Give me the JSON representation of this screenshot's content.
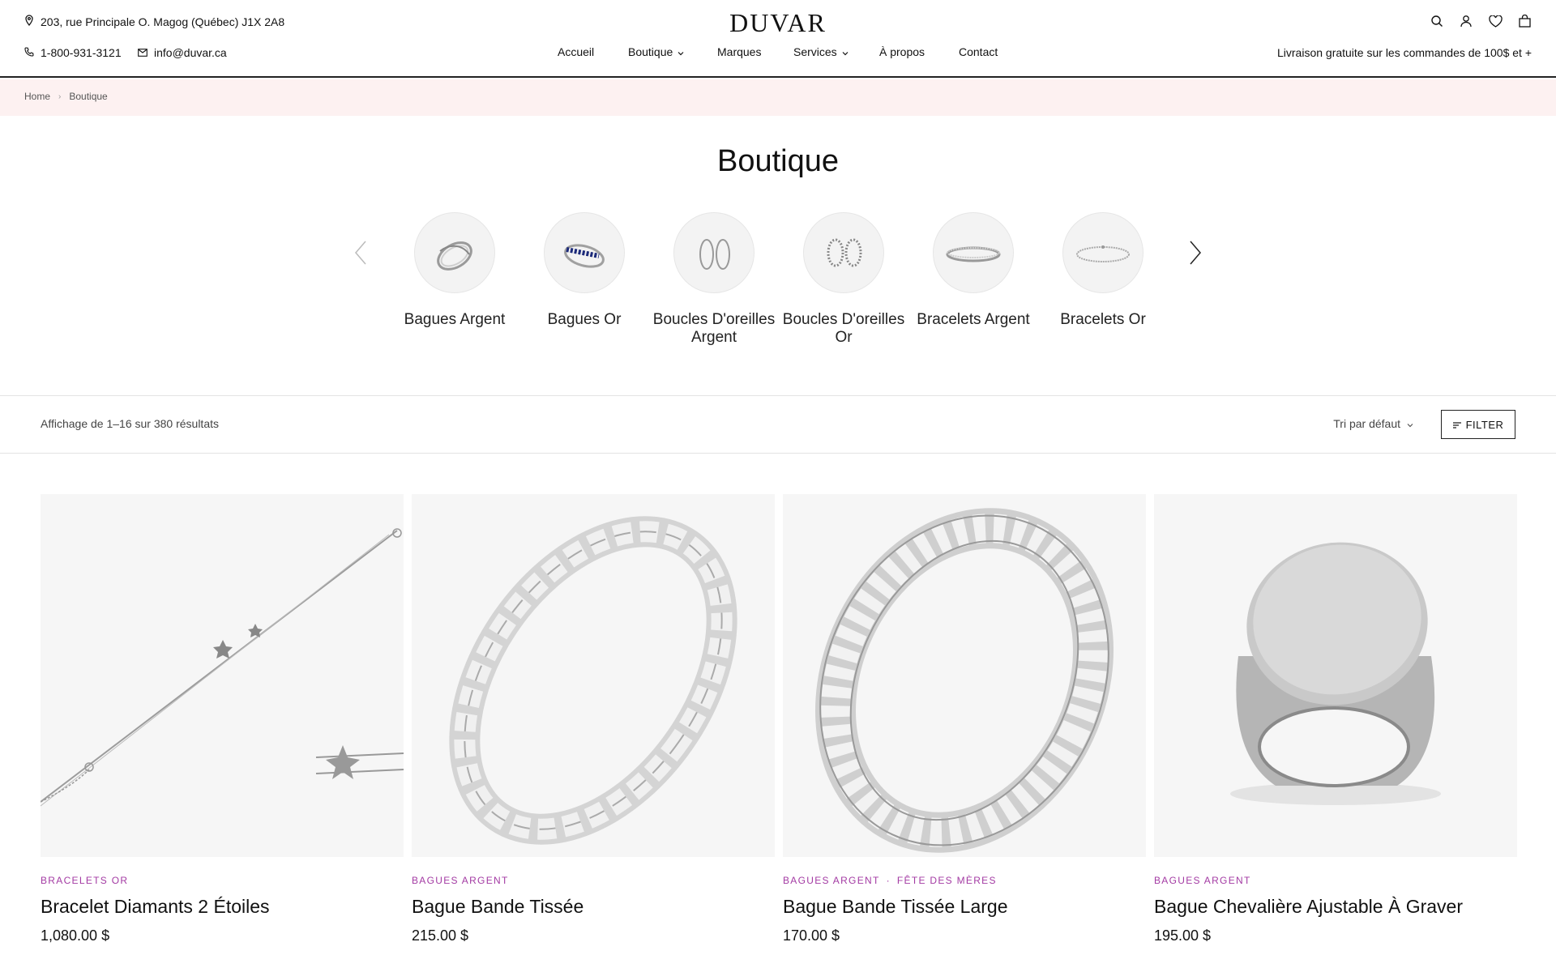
{
  "header": {
    "address": "203, rue Principale O. Magog (Québec) J1X 2A8",
    "phone": "1-800-931-3121",
    "email": "info@duvar.ca",
    "logo": "DUVAR",
    "promo": "Livraison gratuite sur les commandes de 100$ et +",
    "icons": [
      "search-icon",
      "account-icon",
      "heart-icon",
      "bag-icon"
    ]
  },
  "nav": {
    "items": [
      {
        "label": "Accueil",
        "dropdown": false
      },
      {
        "label": "Boutique",
        "dropdown": true
      },
      {
        "label": "Marques",
        "dropdown": false
      },
      {
        "label": "Services",
        "dropdown": true
      },
      {
        "label": "À propos",
        "dropdown": false
      },
      {
        "label": "Contact",
        "dropdown": false
      }
    ]
  },
  "breadcrumb": {
    "home": "Home",
    "current": "Boutique"
  },
  "page": {
    "title": "Boutique"
  },
  "categories": [
    {
      "label": "Bagues Argent",
      "icon": "silver-ring-icon"
    },
    {
      "label": "Bagues Or",
      "icon": "sapphire-ring-icon"
    },
    {
      "label": "Boucles D'oreilles Argent",
      "icon": "hoop-earrings-icon"
    },
    {
      "label": "Boucles D'oreilles Or",
      "icon": "diamond-hoop-earrings-icon"
    },
    {
      "label": "Bracelets Argent",
      "icon": "bangle-icon"
    },
    {
      "label": "Bracelets Or",
      "icon": "tennis-bracelet-icon"
    }
  ],
  "toolbar": {
    "result_count": "Affichage de 1–16 sur 380 résultats",
    "sort_label": "Tri par défaut",
    "filter_label": "FILTER"
  },
  "products": [
    {
      "categories": [
        "Bracelets Or"
      ],
      "name": "Bracelet Diamants 2 Étoiles",
      "price": "1,080.00 $"
    },
    {
      "categories": [
        "Bagues Argent"
      ],
      "name": "Bague Bande Tissée",
      "price": "215.00 $"
    },
    {
      "categories": [
        "Bagues Argent",
        "Fête des Mères"
      ],
      "name": "Bague Bande Tissée Large",
      "price": "170.00 $"
    },
    {
      "categories": [
        "Bagues Argent"
      ],
      "name": "Bague Chevalière Ajustable À Graver",
      "price": "195.00 $"
    }
  ],
  "colors": {
    "category_accent": "#a33aa3",
    "breadcrumb_bg": "#fdf1f1",
    "image_bg": "#f6f6f6"
  }
}
